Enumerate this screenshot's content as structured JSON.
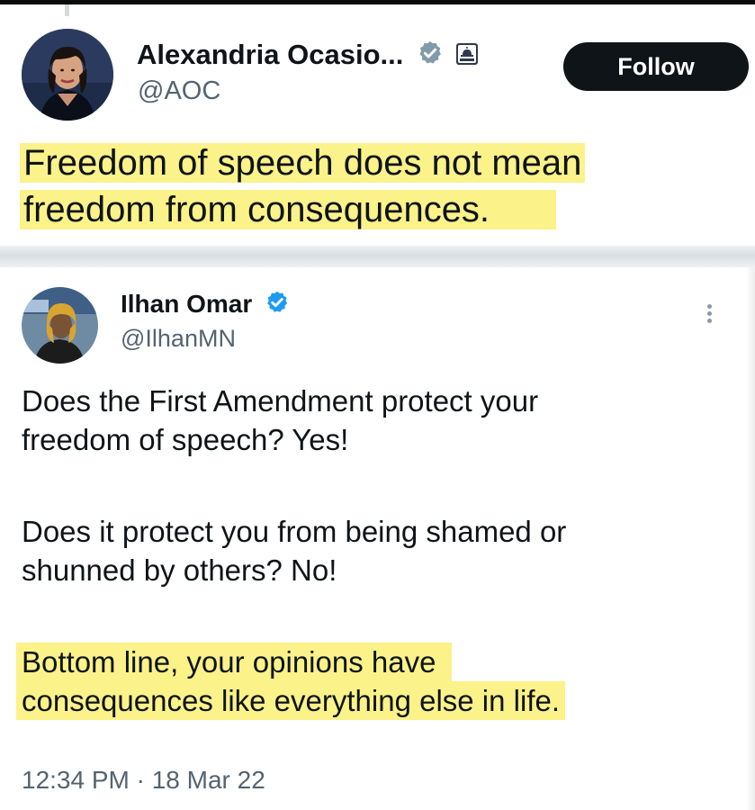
{
  "tweets": [
    {
      "author": {
        "name": "Alexandria Ocasio...",
        "handle": "@AOC",
        "avatar_icon": "profile-photo",
        "verified_icon": "verified-badge-gray",
        "affiliation_icon": "capitol-dome-icon"
      },
      "follow_label": "Follow",
      "text_lines": [
        "Freedom of speech does not mean",
        "freedom from consequences."
      ],
      "highlight_color": "#fbf28a"
    },
    {
      "author": {
        "name": "Ilhan Omar",
        "handle": "@IlhanMN",
        "avatar_icon": "profile-photo",
        "verified_icon": "verified-badge-blue"
      },
      "paragraphs": [
        [
          "Does the First Amendment protect your",
          "freedom of speech? Yes!"
        ],
        [
          "Does it protect you from being shamed or",
          "shunned by others? No!"
        ],
        [
          "Bottom line, your opinions have",
          "consequences like everything else in life."
        ]
      ],
      "timestamp": "12:34 PM · 18 Mar 22",
      "verified_color": "#1d9bf0",
      "highlight_color": "#fbf28a"
    }
  ]
}
